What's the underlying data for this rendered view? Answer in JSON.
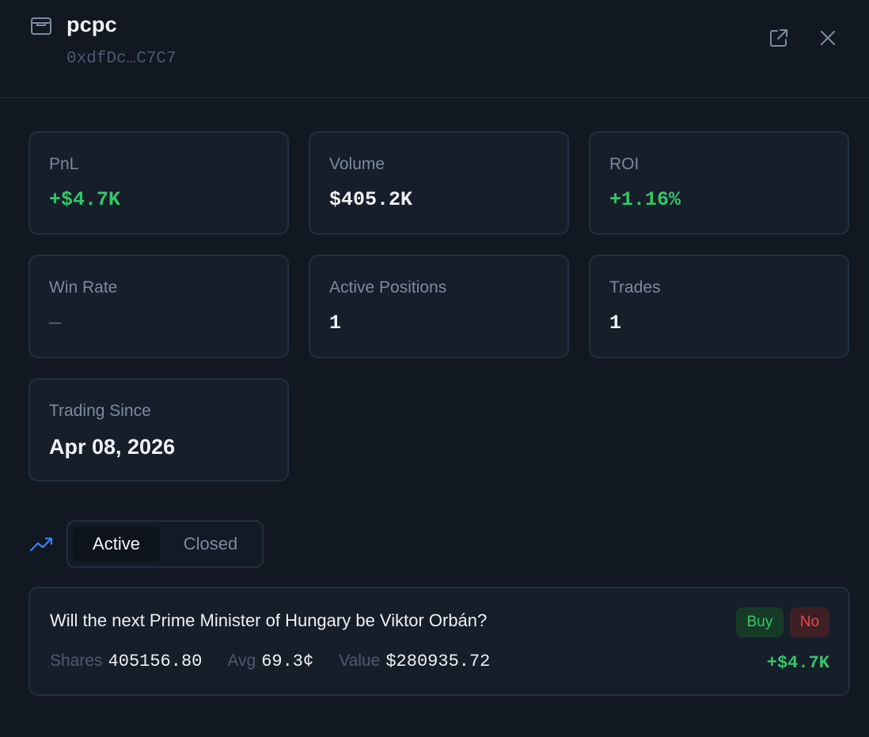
{
  "header": {
    "wallet_name": "pcpc",
    "wallet_address": "0xdfDc…C7C7",
    "icons": {
      "wallet": "wallet-icon",
      "external": "external-link-icon",
      "close": "close-icon"
    }
  },
  "stats": [
    {
      "label": "PnL",
      "value": "+$4.7K"
    },
    {
      "label": "Volume",
      "value": "$405.2K"
    },
    {
      "label": "ROI",
      "value": "+1.16%"
    },
    {
      "label": "Win Rate",
      "value": "—"
    },
    {
      "label": "Active Positions",
      "value": "1"
    },
    {
      "label": "Trades",
      "value": "1"
    },
    {
      "label": "Trading Since",
      "value": "Apr 08, 2026"
    }
  ],
  "tabs": {
    "icon": "trending-up-icon",
    "active_label": "Active",
    "closed_label": "Closed"
  },
  "position": {
    "title": "Will the next Prime Minister of Hungary be Viktor Orbán?",
    "side": "Buy",
    "outcome": "No",
    "shares_label": "Shares",
    "shares": "405156.80",
    "avg_label": "Avg",
    "avg": "69.3¢",
    "value_label": "Value",
    "value": "$280935.72",
    "pnl": "+$4.7K"
  },
  "colors": {
    "background": "#111821",
    "card": "#161e2a",
    "border": "#232f3f",
    "positive": "#34c76a",
    "negative": "#ef4a4a",
    "accent": "#3b82f6"
  }
}
